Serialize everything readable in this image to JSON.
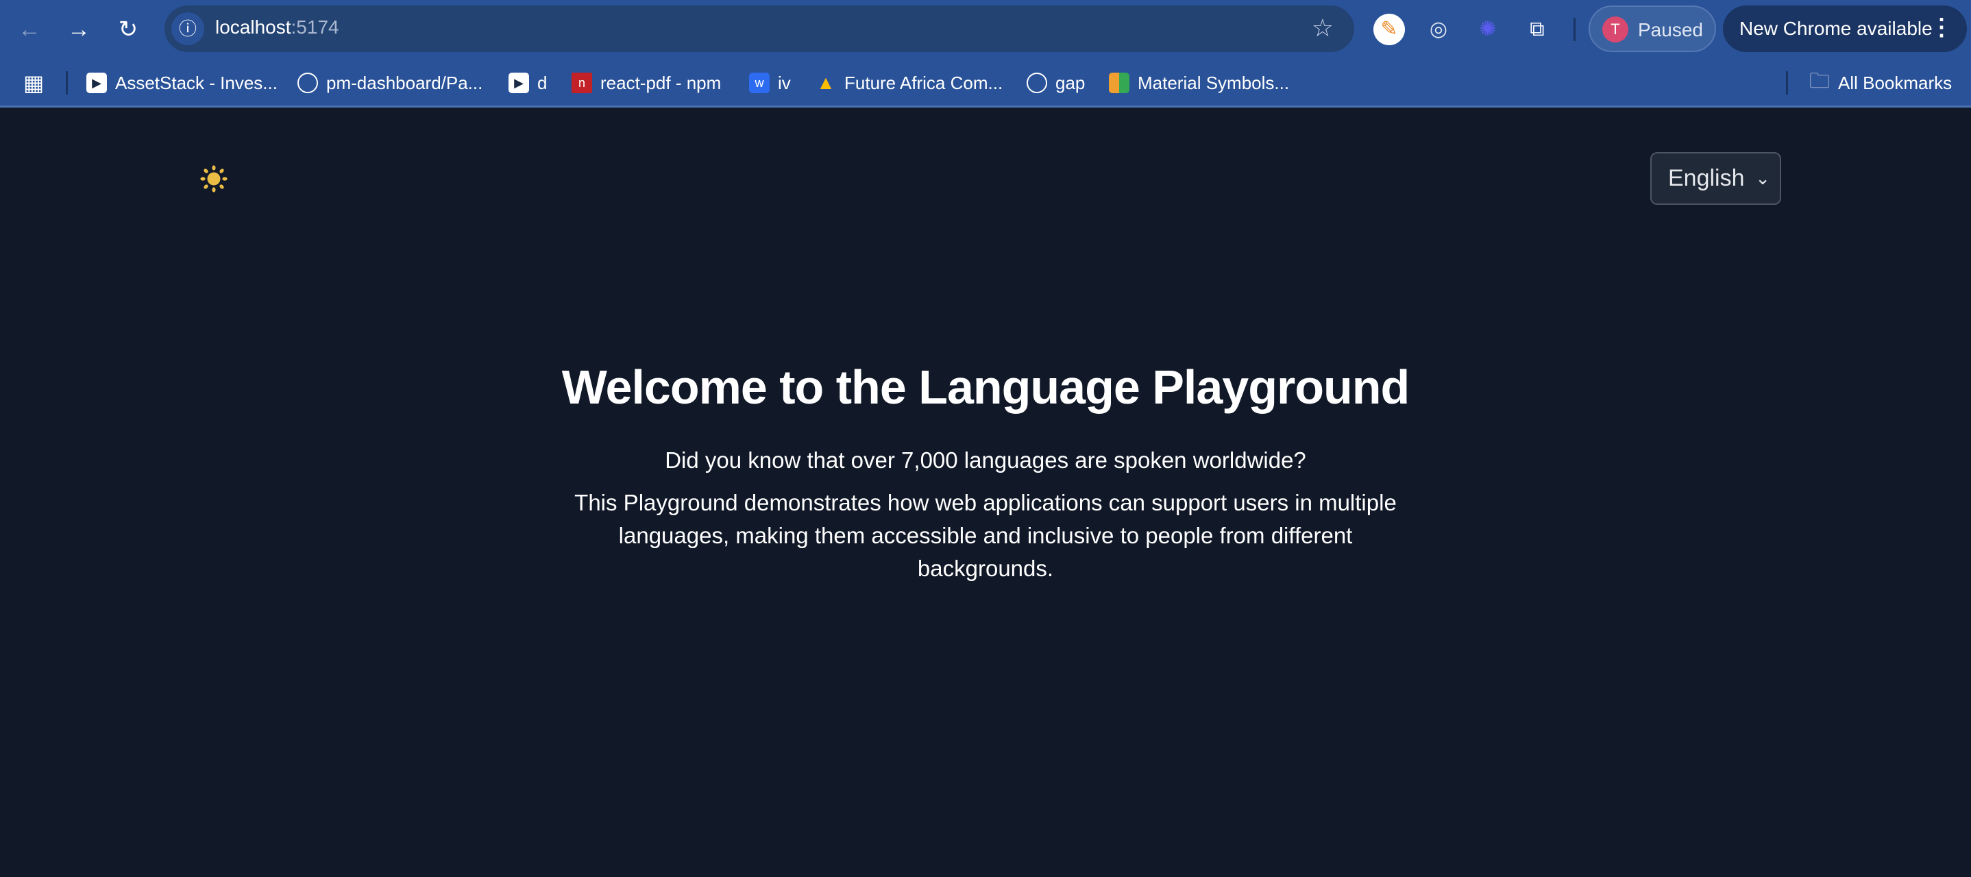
{
  "browser": {
    "url_host": "localhost",
    "url_port": ":5174",
    "profile_initial": "T",
    "profile_status": "Paused",
    "update_label": "New Chrome available",
    "bookmarks": [
      {
        "label": "AssetStack - Inves...",
        "icon": "assetstack-favicon",
        "color": "#ffffff"
      },
      {
        "label": "pm-dashboard/Pa...",
        "icon": "github-icon",
        "color": "#ffffff"
      },
      {
        "label": "d",
        "icon": "assetstack-favicon",
        "color": "#ffffff"
      },
      {
        "label": "react-pdf - npm",
        "icon": "npm-favicon",
        "color": "#c12127"
      },
      {
        "label": "iv",
        "icon": "webflow-favicon",
        "color": "#4353ff"
      },
      {
        "label": "Future Africa Com...",
        "icon": "google-drive-icon",
        "color": "#34a853"
      },
      {
        "label": "gap",
        "icon": "volvo-favicon",
        "color": "#ffffff"
      },
      {
        "label": "Material Symbols...",
        "icon": "google-fonts-favicon",
        "color": "#ea4335"
      }
    ],
    "all_bookmarks": "All Bookmarks"
  },
  "page": {
    "theme_icon": "sun-icon",
    "theme_color": "#ebbd45",
    "language_select": "English",
    "title": "Welcome to the Language Playground",
    "intro": "Did you know that over 7,000 languages are spoken worldwide?",
    "description": "This Playground demonstrates how web applications can support users in multiple languages, making them accessible and inclusive to people from different backgrounds."
  }
}
